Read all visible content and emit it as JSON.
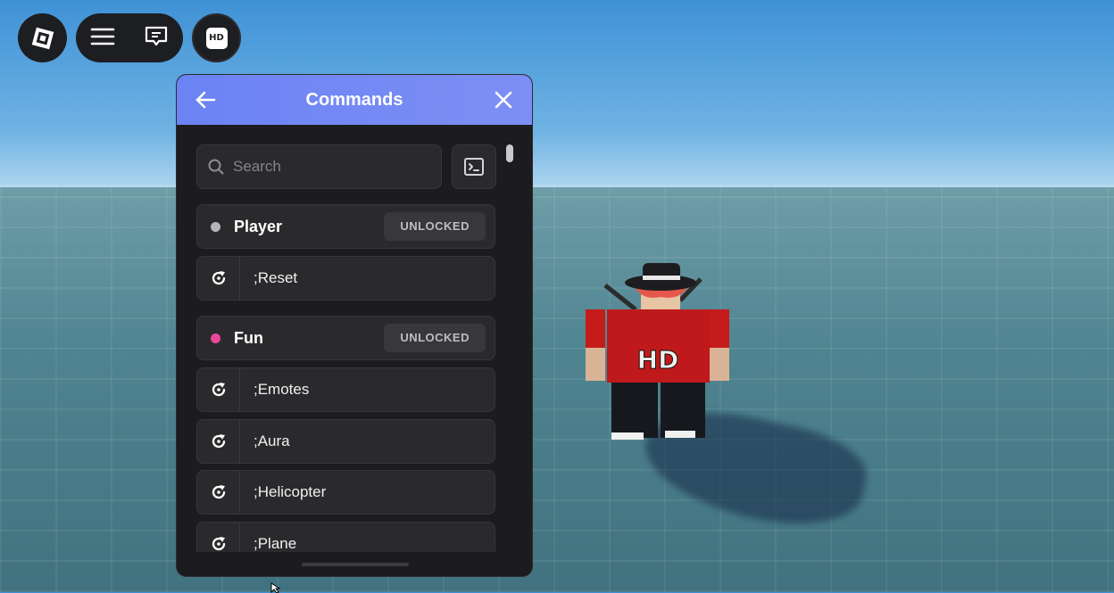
{
  "top_bar": {
    "logo_icon": "roblox-logo-icon",
    "menu_icon": "hamburger-menu-icon",
    "chat_icon": "chat-bubble-icon",
    "hd_badge": "HD"
  },
  "panel": {
    "title": "Commands",
    "back_icon": "arrow-left-icon",
    "close_icon": "close-icon",
    "search": {
      "placeholder": "Search",
      "value": ""
    },
    "console_icon": "terminal-icon",
    "sections": [
      {
        "category": "Player",
        "dot_color": "#b5b5ba",
        "status": "UNLOCKED",
        "commands": [
          ";Reset"
        ]
      },
      {
        "category": "Fun",
        "dot_color": "#e8489a",
        "status": "UNLOCKED",
        "commands": [
          ";Emotes",
          ";Aura",
          ";Helicopter",
          ";Plane"
        ]
      }
    ]
  },
  "colors": {
    "header_accent": "#7186f4",
    "panel_bg": "#1c1c1e",
    "row_bg": "#2a2a2d"
  }
}
